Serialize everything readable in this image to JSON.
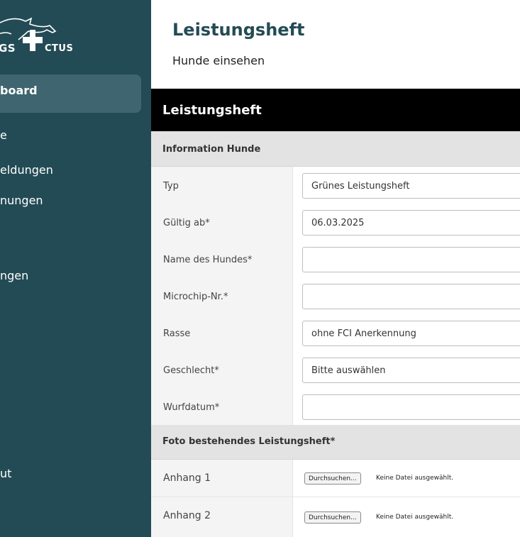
{
  "sidebar": {
    "logo_left": "GS",
    "logo_right": "CTUS",
    "active_item": "board",
    "items": [
      "e",
      "eldungen",
      "nungen",
      "ngen",
      "ut"
    ]
  },
  "header": {
    "title": "Leistungsheft",
    "subtitle": "Hunde einsehen"
  },
  "card": {
    "title": "Leistungsheft"
  },
  "sections": {
    "info": "Information Hunde",
    "photo": "Foto bestehendes Leistungsheft*"
  },
  "fields": [
    {
      "label": "Typ",
      "value": "Grünes Leistungsheft"
    },
    {
      "label": "Gültig ab*",
      "value": "06.03.2025"
    },
    {
      "label": "Name des Hundes*",
      "value": ""
    },
    {
      "label": "Microchip-Nr.*",
      "value": ""
    },
    {
      "label": "Rasse",
      "value": "ohne FCI Anerkennung"
    },
    {
      "label": "Geschlecht*",
      "value": "Bitte auswählen"
    },
    {
      "label": "Wurfdatum*",
      "value": ""
    }
  ],
  "attachments": [
    {
      "label": "Anhang 1",
      "button": "Durchsuchen...",
      "status": "Keine Datei ausgewählt."
    },
    {
      "label": "Anhang 2",
      "button": "Durchsuchen...",
      "status": "Keine Datei ausgewählt."
    }
  ],
  "colors": {
    "sidebar": "#234b55",
    "active_item": "#3f6670",
    "title": "#234b55"
  }
}
